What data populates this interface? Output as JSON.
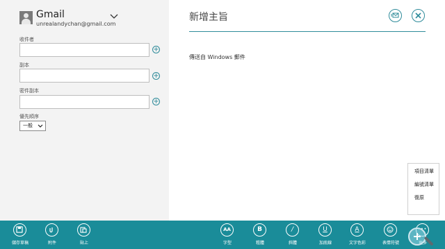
{
  "account": {
    "name": "Gmail",
    "email": "unrealandychan@gmail.com"
  },
  "fields": {
    "to_label": "收件者",
    "cc_label": "副本",
    "bcc_label": "密件副本",
    "priority_label": "優先順序",
    "priority_value": "一般"
  },
  "compose": {
    "subject_placeholder": "新增主旨",
    "body_text": "傳送自 Windows 郵件"
  },
  "context_menu": {
    "items": [
      "項目清單",
      "編號清單",
      "復原"
    ]
  },
  "app_bar": {
    "left": [
      "儲存草稿",
      "附件",
      "貼上"
    ],
    "right": [
      "字型",
      "粗體",
      "斜體",
      "加底線",
      "文字色彩",
      "表情符號",
      "更多"
    ]
  },
  "colors": {
    "accent": "#1a8c99",
    "left_pane": "#f3f3f3"
  }
}
